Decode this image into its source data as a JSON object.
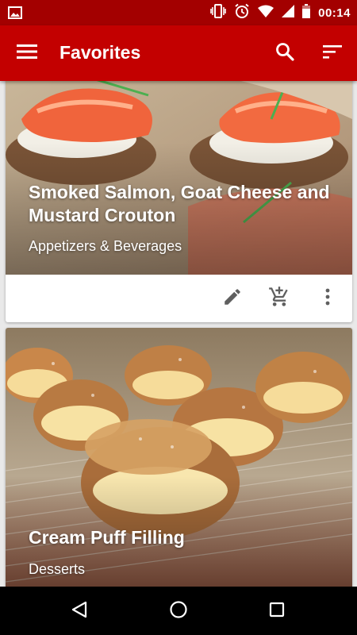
{
  "status_bar": {
    "time": "00:14",
    "icons": [
      "image-icon",
      "vibrate-icon",
      "alarm-icon",
      "wifi-icon",
      "signal-icon",
      "battery-icon"
    ]
  },
  "toolbar": {
    "title": "Favorites",
    "icons": [
      "menu-icon",
      "search-icon",
      "sort-icon"
    ]
  },
  "cards": [
    {
      "title": "Smoked Salmon, Goat Cheese and Mustard Crouton",
      "category": "Appetizers & Beverages",
      "actions": [
        "edit-icon",
        "add-to-cart-icon",
        "more-vert-icon"
      ]
    },
    {
      "title": "Cream Puff Filling",
      "category": "Desserts"
    }
  ],
  "nav_bar": {
    "icons": [
      "back-icon",
      "home-icon",
      "recents-icon"
    ]
  },
  "colors": {
    "status_bar": "#a30000",
    "toolbar": "#c30000",
    "background": "#e9e9e9"
  }
}
